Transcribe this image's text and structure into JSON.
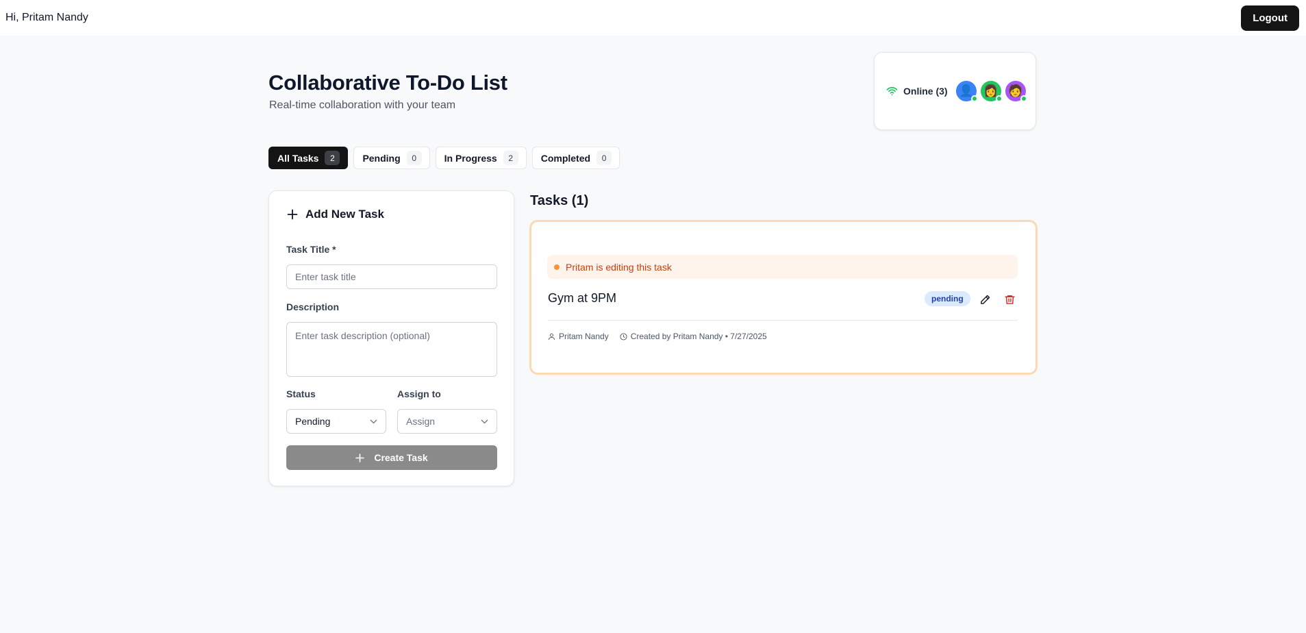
{
  "header": {
    "greeting": "Hi, Pritam Nandy",
    "logout_label": "Logout"
  },
  "page": {
    "title": "Collaborative To-Do List",
    "subtitle": "Real-time collaboration with your team"
  },
  "presence": {
    "label": "Online (3)",
    "icon": "wifi-icon",
    "avatars": [
      {
        "emoji": "👤",
        "bg": "#3b82f6"
      },
      {
        "emoji": "👩",
        "bg": "#22c55e"
      },
      {
        "emoji": "🧑",
        "bg": "#a855f7"
      }
    ],
    "status_color": "#22c55e"
  },
  "tabs": [
    {
      "label": "All Tasks",
      "count": "2",
      "active": true
    },
    {
      "label": "Pending",
      "count": "0",
      "active": false
    },
    {
      "label": "In Progress",
      "count": "2",
      "active": false
    },
    {
      "label": "Completed",
      "count": "0",
      "active": false
    }
  ],
  "form": {
    "heading": "Add New Task",
    "title_label": "Task Title *",
    "title_placeholder": "Enter task title",
    "title_value": "",
    "description_label": "Description",
    "description_placeholder": "Enter task description (optional)",
    "description_value": "",
    "status_label": "Status",
    "status_value": "Pending",
    "assign_label": "Assign to",
    "assign_placeholder": "Assign",
    "submit_label": "Create Task"
  },
  "tasks": {
    "heading": "Tasks (1)",
    "items": [
      {
        "editing_notice": "Pritam is editing this task",
        "title": "Gym at 9PM",
        "status": "pending",
        "assignee": "Pritam Nandy",
        "created": "Created by Pritam Nandy • 7/27/2025"
      }
    ]
  },
  "colors": {
    "accent_dark": "#141414",
    "editing_border": "#fcd9b0",
    "editing_text": "#c2410c",
    "delete_red": "#dc2626",
    "badge_bg": "#dbeafe",
    "badge_text": "#1e40af"
  }
}
